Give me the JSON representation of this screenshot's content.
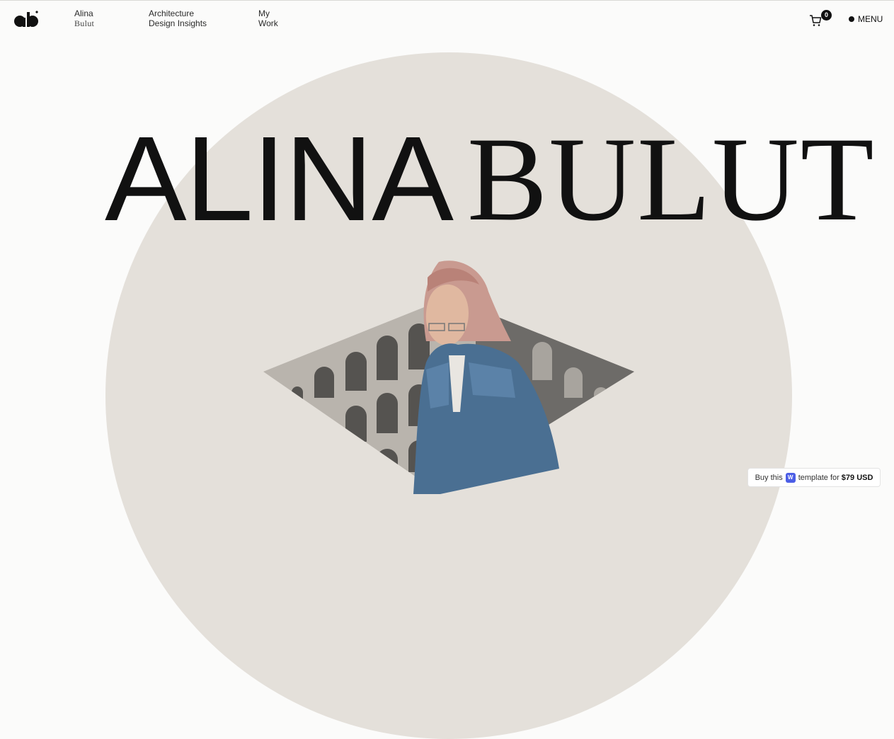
{
  "header": {
    "logo_text": "ab",
    "nav": [
      {
        "line1": "Alina",
        "line2": "Bulut"
      },
      {
        "line1": "Architecture",
        "line2": "Design Insights"
      },
      {
        "line1": "My",
        "line2": "Work"
      }
    ],
    "cart_count": "0",
    "menu_label": "MENU"
  },
  "hero": {
    "first_name": "ALINA",
    "last_name": "BULUT"
  },
  "badge": {
    "prefix": "Buy this",
    "webflow_icon": "W",
    "middle": "template for",
    "price": "$79 USD"
  },
  "colors": {
    "background": "#fbfbfa",
    "circle": "#e4e0da",
    "text": "#111111",
    "webflow_blue": "#4c5ee6"
  }
}
